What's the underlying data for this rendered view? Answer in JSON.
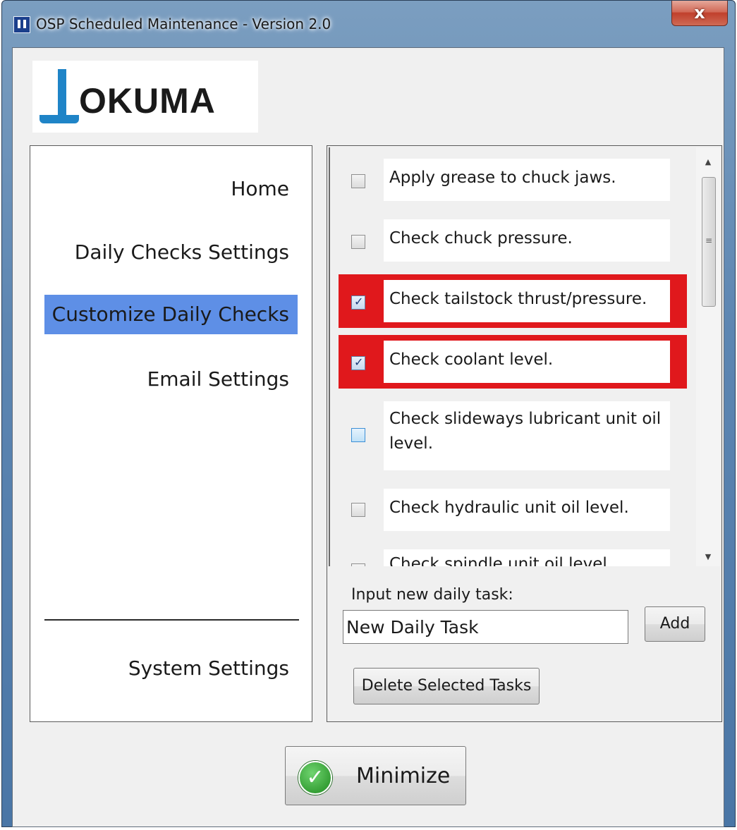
{
  "window": {
    "title": "OSP Scheduled Maintenance - Version 2.0",
    "close_label": "x"
  },
  "logo": {
    "text": "OKUMA"
  },
  "nav": {
    "items": [
      {
        "label": "Home"
      },
      {
        "label": "Daily Checks Settings"
      },
      {
        "label": "Customize Daily Checks",
        "selected": true
      },
      {
        "label": "Email Settings"
      }
    ],
    "system_settings": "System Settings"
  },
  "tasks": [
    {
      "label": "Apply grease to chuck jaws.",
      "checked": false
    },
    {
      "label": "Check chuck pressure.",
      "checked": false
    },
    {
      "label": "Check tailstock thrust/pressure.",
      "checked": true
    },
    {
      "label": "Check coolant level.",
      "checked": true
    },
    {
      "label": "Check slideways lubricant unit oil level.",
      "checked": false
    },
    {
      "label": "Check hydraulic unit oil level.",
      "checked": false
    },
    {
      "label": "Check spindle unit oil level",
      "checked": false
    }
  ],
  "new_task": {
    "label": "Input new daily task:",
    "value": "New Daily Task"
  },
  "buttons": {
    "add": "Add",
    "delete": "Delete Selected Tasks",
    "minimize": "Minimize"
  },
  "colors": {
    "nav_selected": "#5e8fe6",
    "highlight_red": "#e0181c",
    "logo_blue": "#1f84c7",
    "check_green": "#1e8a1e"
  }
}
